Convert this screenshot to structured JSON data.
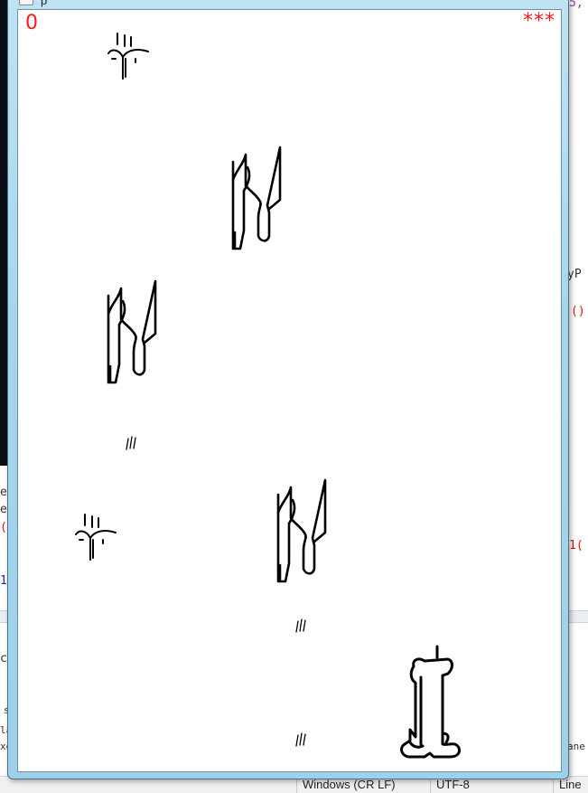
{
  "game": {
    "score": "0",
    "lives": "***"
  },
  "background_ide": {
    "gutter_fragments": [
      "5,",
      "yP",
      "()",
      "1(",
      "e",
      "e",
      "(",
      "1",
      "co",
      "s",
      "la",
      "xe",
      "ane"
    ],
    "status_bar": {
      "line_ending": "Windows (CR LF)",
      "encoding": "UTF-8",
      "position": "Line"
    }
  },
  "sprites": [
    {
      "kind": "flame-enemy"
    },
    {
      "kind": "legs-enemy"
    },
    {
      "kind": "legs-enemy"
    },
    {
      "kind": "bullet"
    },
    {
      "kind": "flame-enemy"
    },
    {
      "kind": "legs-enemy"
    },
    {
      "kind": "bullet"
    },
    {
      "kind": "bullet"
    },
    {
      "kind": "player-ship"
    }
  ],
  "colors": {
    "hud_text": "#ff1a1a",
    "sprite_ink": "#000000",
    "window_frame": "#a6d6ee"
  }
}
